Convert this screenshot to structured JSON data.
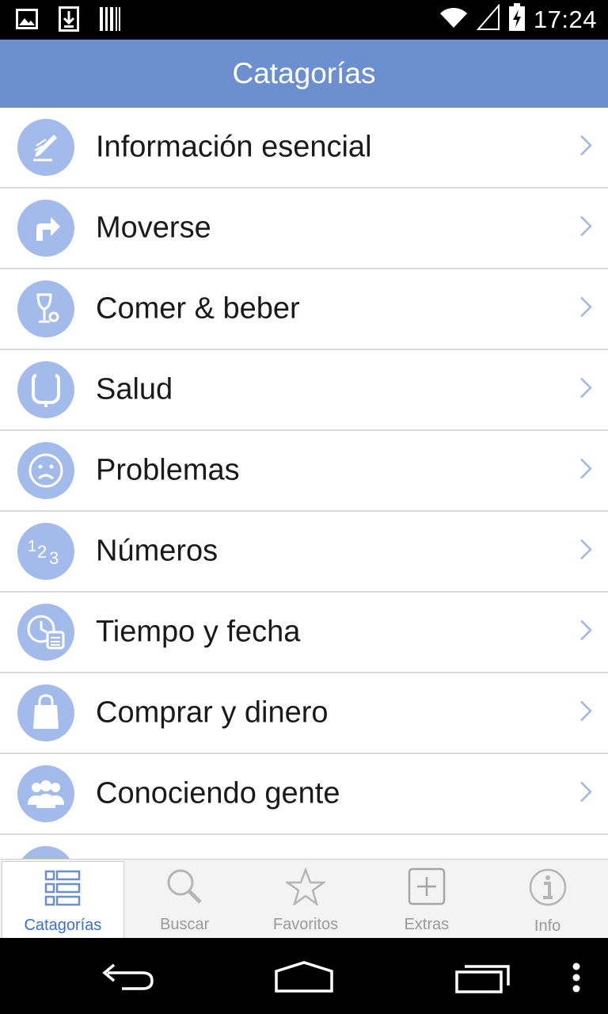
{
  "status_bar": {
    "time": "17:24",
    "icons": [
      "image-icon",
      "download-icon",
      "barcode-icon",
      "wifi-icon",
      "signal-icon",
      "battery-icon"
    ]
  },
  "header": {
    "title": "Catagorías"
  },
  "categories": [
    {
      "label": "Información esencial",
      "icon": "pencil-icon"
    },
    {
      "label": "Moverse",
      "icon": "turn-right-arrow-icon"
    },
    {
      "label": "Comer & beber",
      "icon": "wine-glass-icon"
    },
    {
      "label": "Salud",
      "icon": "stethoscope-icon"
    },
    {
      "label": "Problemas",
      "icon": "sad-face-icon"
    },
    {
      "label": "Números",
      "icon": "numbers-icon"
    },
    {
      "label": "Tiempo y fecha",
      "icon": "clock-calendar-icon"
    },
    {
      "label": "Comprar y dinero",
      "icon": "shopping-bag-icon"
    },
    {
      "label": "Conociendo gente",
      "icon": "people-icon"
    }
  ],
  "tabs": [
    {
      "label": "Catagorías",
      "icon": "list-icon",
      "active": true
    },
    {
      "label": "Buscar",
      "icon": "magnifier-icon",
      "active": false
    },
    {
      "label": "Favoritos",
      "icon": "star-icon",
      "active": false
    },
    {
      "label": "Extras",
      "icon": "plus-box-icon",
      "active": false
    },
    {
      "label": "Info",
      "icon": "info-icon",
      "active": false
    }
  ],
  "colors": {
    "header_bg": "#6b8fcf",
    "icon_circle": "#a3bbea",
    "chevron": "#9fb6e6",
    "active_tab": "#3a6fd0"
  }
}
